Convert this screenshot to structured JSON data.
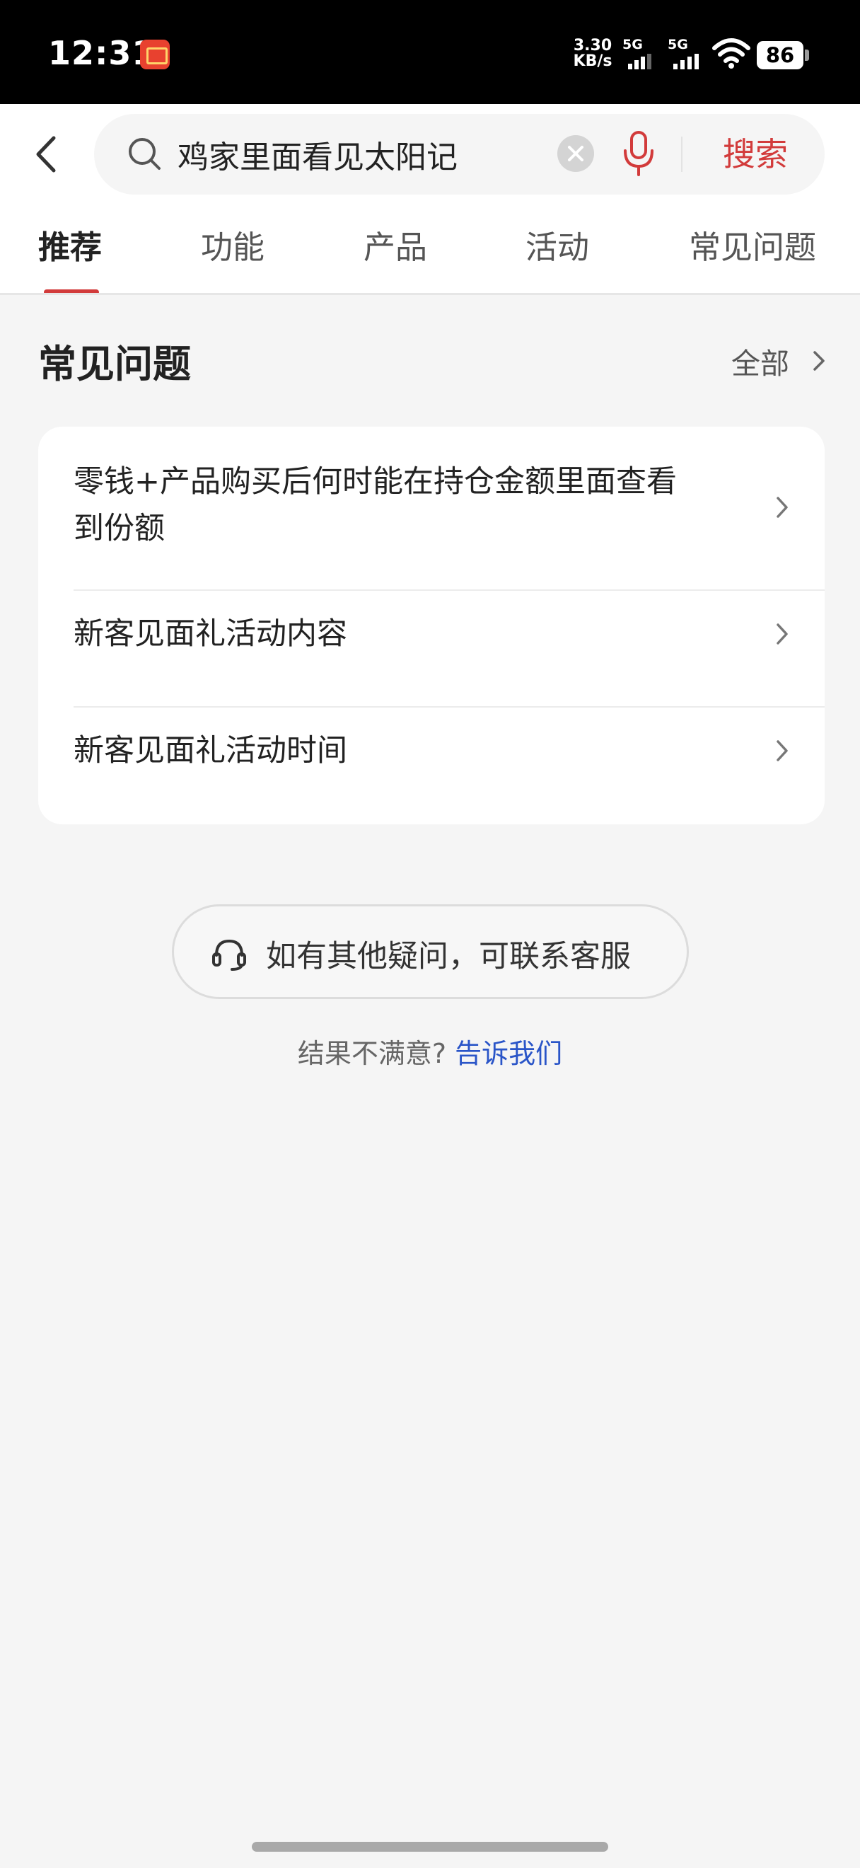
{
  "status_bar": {
    "time": "12:31",
    "net_speed_value": "3.30",
    "net_speed_unit": "KB/s",
    "sim1_label": "5G",
    "sim2_label": "5G",
    "battery": "86"
  },
  "search": {
    "query": "鸡家里面看见太阳记",
    "button_label": "搜索"
  },
  "tabs": [
    {
      "label": "推荐",
      "active": true
    },
    {
      "label": "功能",
      "active": false
    },
    {
      "label": "产品",
      "active": false
    },
    {
      "label": "活动",
      "active": false
    },
    {
      "label": "常见问题",
      "active": false
    }
  ],
  "faq_section": {
    "title": "常见问题",
    "see_all": "全部",
    "items": [
      {
        "line1": "零钱+产品购买后何时能在持仓金额里面查看",
        "line2": "到份额"
      },
      {
        "text": "新客见面礼活动内容"
      },
      {
        "text": "新客见面礼活动时间"
      }
    ]
  },
  "contact": {
    "label": "如有其他疑问，可联系客服"
  },
  "feedback": {
    "label": "结果不满意?",
    "link": "告诉我们"
  },
  "colors": {
    "accent": "#d23b3b",
    "link": "#2a55c8",
    "background": "#f5f5f5"
  },
  "icons": [
    "back-arrow-icon",
    "search-icon",
    "clear-icon",
    "microphone-icon",
    "chevron-right-icon",
    "headset-icon",
    "wifi-icon",
    "battery-icon",
    "signal-icon"
  ]
}
